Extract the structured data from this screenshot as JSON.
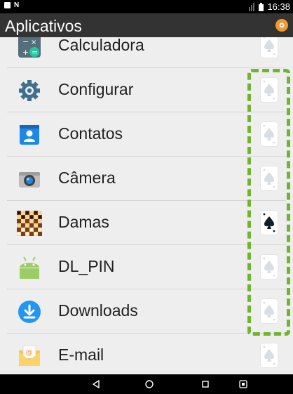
{
  "status_bar": {
    "time": "16:38"
  },
  "header": {
    "title": "Aplicativos"
  },
  "apps": [
    {
      "label": "Calculadora",
      "icon": "calculator-icon",
      "card_highlighted": false
    },
    {
      "label": "Configurar",
      "icon": "settings-gear-icon",
      "card_highlighted": false
    },
    {
      "label": "Contatos",
      "icon": "contacts-icon",
      "card_highlighted": false
    },
    {
      "label": "Câmera",
      "icon": "camera-icon",
      "card_highlighted": false
    },
    {
      "label": "Damas",
      "icon": "checkers-board-icon",
      "card_highlighted": true
    },
    {
      "label": "DL_PIN",
      "icon": "android-icon",
      "card_highlighted": false
    },
    {
      "label": "Downloads",
      "icon": "download-icon",
      "card_highlighted": false
    },
    {
      "label": "E-mail",
      "icon": "email-icon",
      "card_highlighted": false
    }
  ],
  "colors": {
    "dash_highlight": "#6fb52d",
    "header_bg": "#333333",
    "list_bg": "#eeeeee",
    "card_active": "#0d1f2b",
    "card_faded": "#d8dee2"
  },
  "nav_bar": {
    "buttons": [
      "back",
      "home",
      "recents",
      "screenshot"
    ]
  }
}
